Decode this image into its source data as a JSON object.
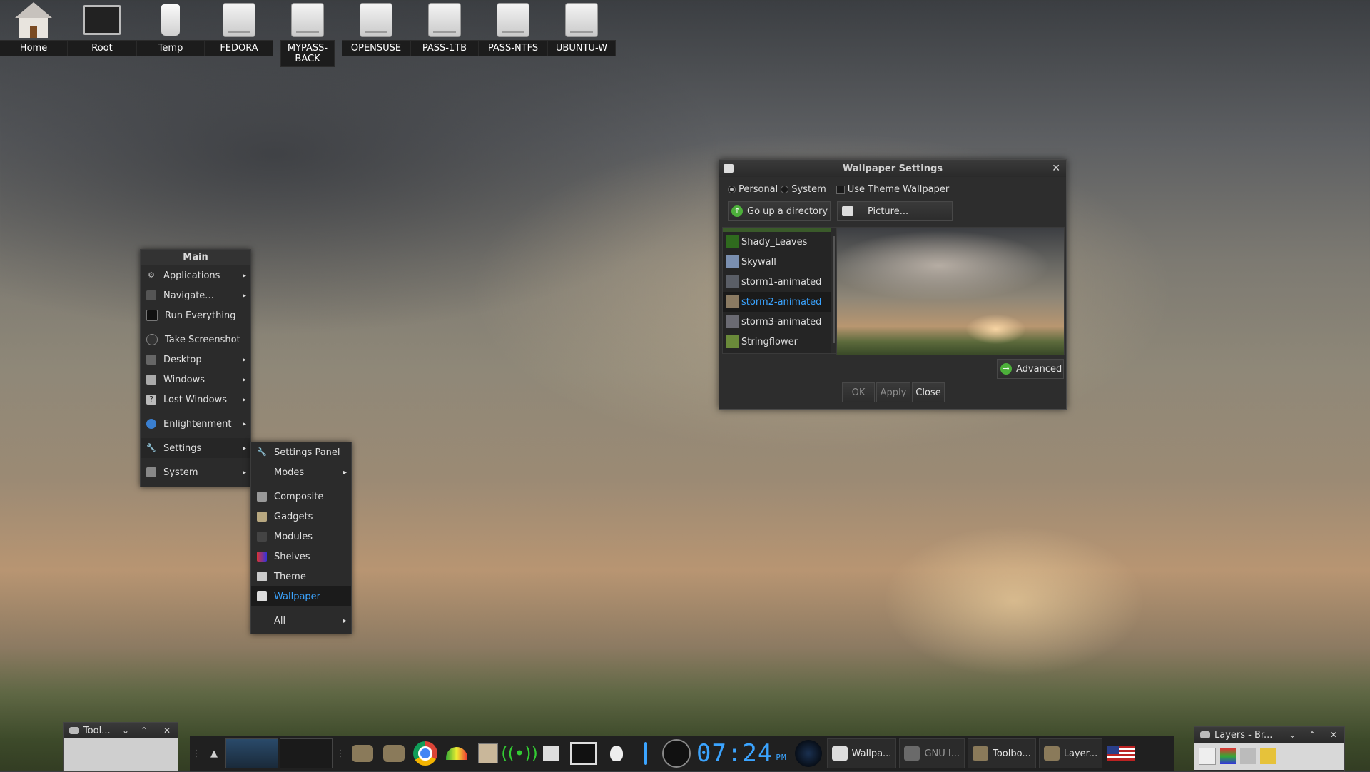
{
  "desktop_icons": [
    {
      "label": "Home",
      "icon": "home-icon"
    },
    {
      "label": "Root",
      "icon": "monitor-icon"
    },
    {
      "label": "Temp",
      "icon": "bottle-icon"
    },
    {
      "label": "FEDORA",
      "icon": "drive-icon"
    },
    {
      "label": "MYPASS-BACK",
      "icon": "drive-icon"
    },
    {
      "label": "OPENSUSE",
      "icon": "drive-icon"
    },
    {
      "label": "PASS-1TB",
      "icon": "drive-icon"
    },
    {
      "label": "PASS-NTFS",
      "icon": "drive-icon"
    },
    {
      "label": "UBUNTU-W",
      "icon": "drive-icon"
    }
  ],
  "main_menu": {
    "title": "Main",
    "items": [
      {
        "label": "Applications",
        "submenu": true
      },
      {
        "label": "Navigate...",
        "submenu": true
      },
      {
        "label": "Run Everything",
        "submenu": false
      },
      {
        "label": "Take Screenshot",
        "submenu": false
      },
      {
        "label": "Desktop",
        "submenu": true
      },
      {
        "label": "Windows",
        "submenu": true
      },
      {
        "label": "Lost Windows",
        "submenu": true
      },
      {
        "label": "Enlightenment",
        "submenu": true
      },
      {
        "label": "Settings",
        "submenu": true
      },
      {
        "label": "System",
        "submenu": true
      }
    ]
  },
  "settings_menu": {
    "items": [
      {
        "label": "Settings Panel"
      },
      {
        "label": "Modes"
      },
      {
        "label": "Composite"
      },
      {
        "label": "Gadgets"
      },
      {
        "label": "Modules"
      },
      {
        "label": "Shelves"
      },
      {
        "label": "Theme"
      },
      {
        "label": "Wallpaper"
      },
      {
        "label": "All"
      }
    ]
  },
  "wallpaper_dialog": {
    "title": "Wallpaper Settings",
    "radio_personal": "Personal",
    "radio_system": "System",
    "use_theme": "Use Theme Wallpaper",
    "go_up": "Go up a directory",
    "picture": "Picture...",
    "files": [
      "Shady_Leaves",
      "Skywall",
      "storm1-animated",
      "storm2-animated",
      "storm3-animated",
      "Stringflower"
    ],
    "selected_file": "storm2-animated",
    "advanced": "Advanced",
    "ok": "OK",
    "apply": "Apply",
    "close": "Close"
  },
  "taskbar": {
    "clock": "07:24",
    "ampm": "PM",
    "tasks": [
      "Wallpa...",
      "GNU I...",
      "Toolbo...",
      "Layer..."
    ]
  },
  "tool_shelf": {
    "title": "Tool..."
  },
  "layers_shelf": {
    "title": "Layers - Br..."
  }
}
